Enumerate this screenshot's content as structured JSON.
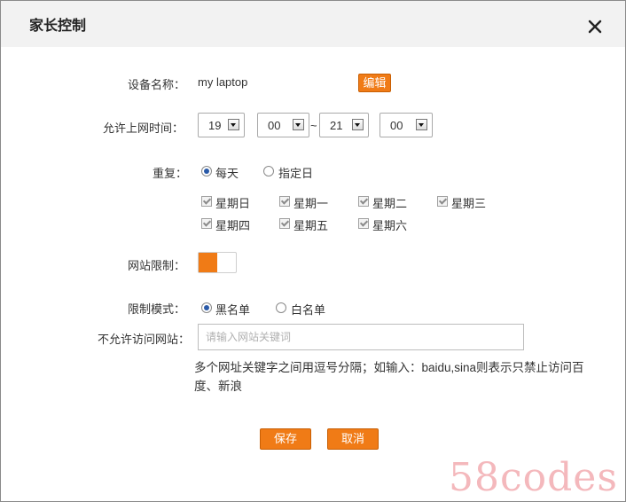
{
  "dialog": {
    "title": "家长控制"
  },
  "device": {
    "label": "设备名称：",
    "value": "my laptop",
    "edit_label": "编辑"
  },
  "time": {
    "label": "允许上网时间：",
    "start_hour": "19",
    "start_min": "00",
    "separator": "~",
    "end_hour": "21",
    "end_min": "00"
  },
  "repeat": {
    "label": "重复：",
    "options": [
      "每天",
      "指定日"
    ],
    "selected": "每天",
    "days": [
      "星期日",
      "星期一",
      "星期二",
      "星期三",
      "星期四",
      "星期五",
      "星期六"
    ]
  },
  "site_limit": {
    "label": "网站限制：",
    "enabled": true
  },
  "mode": {
    "label": "限制模式：",
    "options": [
      "黑名单",
      "白名单"
    ],
    "selected": "黑名单"
  },
  "blocked": {
    "label": "不允许访问网站：",
    "placeholder": "请输入网站关键词",
    "hint": "多个网址关键字之间用逗号分隔；如输入：baidu,sina则表示只禁止访问百度、新浪"
  },
  "actions": {
    "save": "保存",
    "cancel": "取消"
  },
  "watermark": "58codes",
  "colors": {
    "accent": "#f07b16",
    "header_bg": "#f2f2f2",
    "radio_dot": "#2a5aa8"
  }
}
